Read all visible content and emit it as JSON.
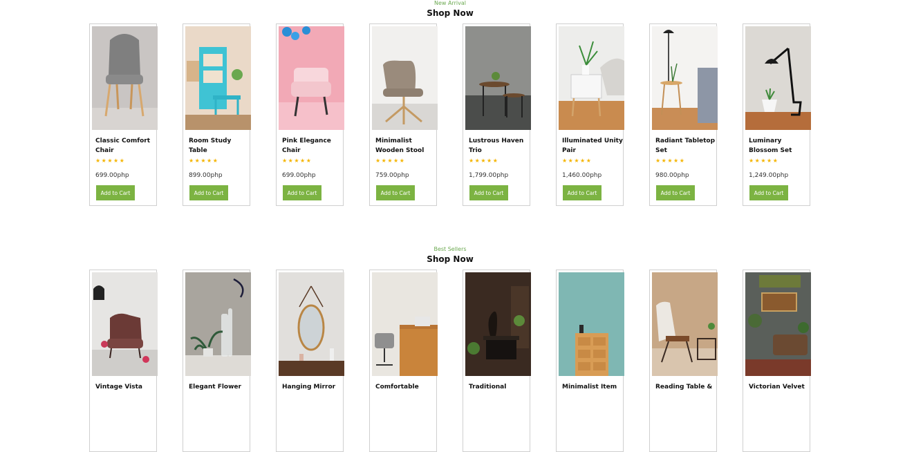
{
  "new_arrival": {
    "eyebrow": "New Arrival",
    "title": "Shop Now",
    "products": [
      {
        "name": "Classic Comfort Chair",
        "price": "699.00php",
        "rating": 5,
        "stars": "★★★★★",
        "cart_label": "Add to Cart",
        "image": "chair-photo"
      },
      {
        "name": "Room Study Table",
        "price": "899.00php",
        "rating": 5,
        "stars": "★★★★★",
        "cart_label": "Add to Cart",
        "image": "study-table-photo"
      },
      {
        "name": "Pink Elegance Chair",
        "price": "699.00php",
        "rating": 5,
        "stars": "★★★★★",
        "cart_label": "Add to Cart",
        "image": "pink-chair-photo"
      },
      {
        "name": "Minimalist Wooden Stool",
        "price": "759.00php",
        "rating": 5,
        "stars": "★★★★★",
        "cart_label": "Add to Cart",
        "image": "stool-photo"
      },
      {
        "name": "Lustrous Haven Trio",
        "price": "1,799.00php",
        "rating": 5,
        "stars": "★★★★★",
        "cart_label": "Add to Cart",
        "image": "trio-table-photo"
      },
      {
        "name": "Illuminated Unity Pair",
        "price": "1,460.00php",
        "rating": 5,
        "stars": "★★★★★",
        "cart_label": "Add to Cart",
        "image": "nightstand-photo"
      },
      {
        "name": "Radiant Tabletop Set",
        "price": "980.00php",
        "rating": 5,
        "stars": "★★★★★",
        "cart_label": "Add to Cart",
        "image": "floor-lamp-photo"
      },
      {
        "name": "Luminary Blossom Set",
        "price": "1,249.00php",
        "rating": 5,
        "stars": "★★★★★",
        "cart_label": "Add to Cart",
        "image": "desk-lamp-photo"
      }
    ]
  },
  "best_sellers": {
    "eyebrow": "Best Sellers",
    "title": "Shop Now",
    "products": [
      {
        "name": "Vintage Vista",
        "image": "vintage-armchair-photo"
      },
      {
        "name": "Elegant Flower",
        "image": "flower-vase-photo"
      },
      {
        "name": "Hanging Mirror",
        "image": "mirror-photo"
      },
      {
        "name": "Comfortable",
        "image": "office-desk-photo"
      },
      {
        "name": "Traditional",
        "image": "traditional-room-photo"
      },
      {
        "name": "Minimalist Item",
        "image": "drawer-cabinet-photo"
      },
      {
        "name": "Reading Table &",
        "image": "reading-corner-photo"
      },
      {
        "name": "Victorian Velvet",
        "image": "victorian-room-photo"
      }
    ]
  },
  "colors": {
    "accent": "#7cb342",
    "eyebrow": "#6aa84f",
    "star": "#f4b400"
  }
}
